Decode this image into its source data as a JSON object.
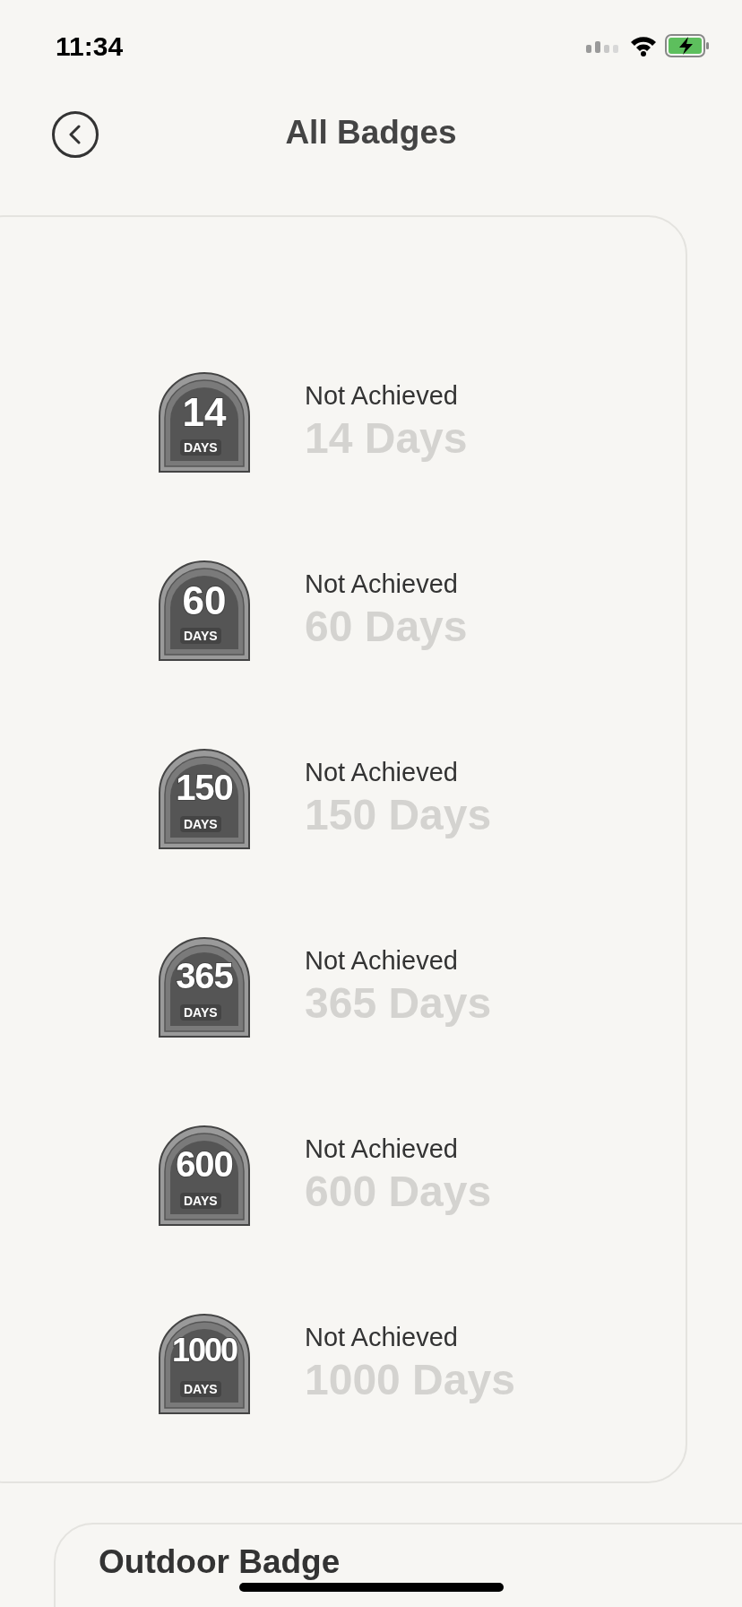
{
  "status_bar": {
    "time": "11:34"
  },
  "header": {
    "title": "All Badges"
  },
  "badges": [
    {
      "number": "14",
      "caption": "DAYS",
      "status": "Not Achieved",
      "title": "14 Days",
      "achieved": false
    },
    {
      "number": "60",
      "caption": "DAYS",
      "status": "Not Achieved",
      "title": "60 Days",
      "achieved": false
    },
    {
      "number": "150",
      "caption": "DAYS",
      "status": "Not Achieved",
      "title": "150 Days",
      "achieved": false
    },
    {
      "number": "365",
      "caption": "DAYS",
      "status": "Not Achieved",
      "title": "365 Days",
      "achieved": false
    },
    {
      "number": "600",
      "caption": "DAYS",
      "status": "Not Achieved",
      "title": "600 Days",
      "achieved": false
    },
    {
      "number": "1000",
      "caption": "DAYS",
      "status": "Not Achieved",
      "title": "1000 Days",
      "achieved": false
    }
  ],
  "next_section": {
    "title": "Outdoor Badge"
  }
}
